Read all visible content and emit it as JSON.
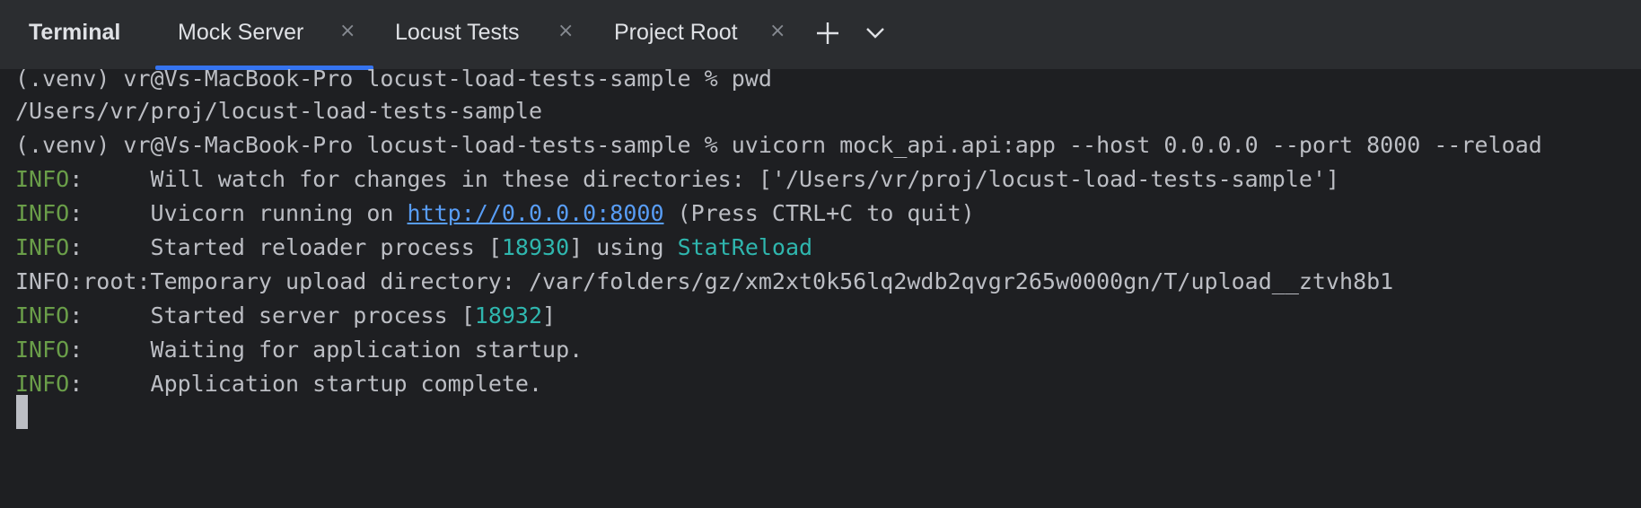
{
  "tabbar": {
    "title": "Terminal",
    "tabs": [
      {
        "label": "Mock Server",
        "active": true
      },
      {
        "label": "Locust Tests",
        "active": false
      },
      {
        "label": "Project Root",
        "active": false
      }
    ],
    "close_glyph": "×",
    "new_tab_icon": "plus-icon",
    "more_tabs_icon": "chevron-down-icon",
    "accent_color": "#3574f0"
  },
  "terminal": {
    "lines": [
      {
        "text": "(.venv) vr@Vs-MacBook-Pro locust-load-tests-sample % pwd"
      },
      {
        "text": "/Users/vr/proj/locust-load-tests-sample"
      },
      {
        "text": "(.venv) vr@Vs-MacBook-Pro locust-load-tests-sample % uvicorn mock_api.api:app --host 0.0.0.0 --port 8000 --reload"
      },
      {
        "level": "INFO",
        "sep": ":     ",
        "text": "Will watch for changes in these directories: ['/Users/vr/proj/locust-load-tests-sample']"
      },
      {
        "level": "INFO",
        "sep": ":     ",
        "before": "Uvicorn running on ",
        "link": "http://0.0.0.0:8000",
        "after": " (Press CTRL+C to quit)"
      },
      {
        "level": "INFO",
        "sep": ":     ",
        "before": "Started reloader process [",
        "num": "18930",
        "mid": "] using ",
        "highlight": "StatReload"
      },
      {
        "text": "INFO:root:Temporary upload directory: /var/folders/gz/xm2xt0k56lq2wdb2qvgr265w0000gn/T/upload__ztvh8b1"
      },
      {
        "level": "INFO",
        "sep": ":     ",
        "before": "Started server process [",
        "num": "18932",
        "after": "]"
      },
      {
        "level": "INFO",
        "sep": ":     ",
        "text": "Waiting for application startup."
      },
      {
        "level": "INFO",
        "sep": ":     ",
        "text": "Application startup complete."
      }
    ],
    "colors": {
      "background": "#1e1f22",
      "text": "#bcbec4",
      "info": "#6a9e49",
      "number": "#2fb6ae",
      "link": "#589df6"
    }
  }
}
